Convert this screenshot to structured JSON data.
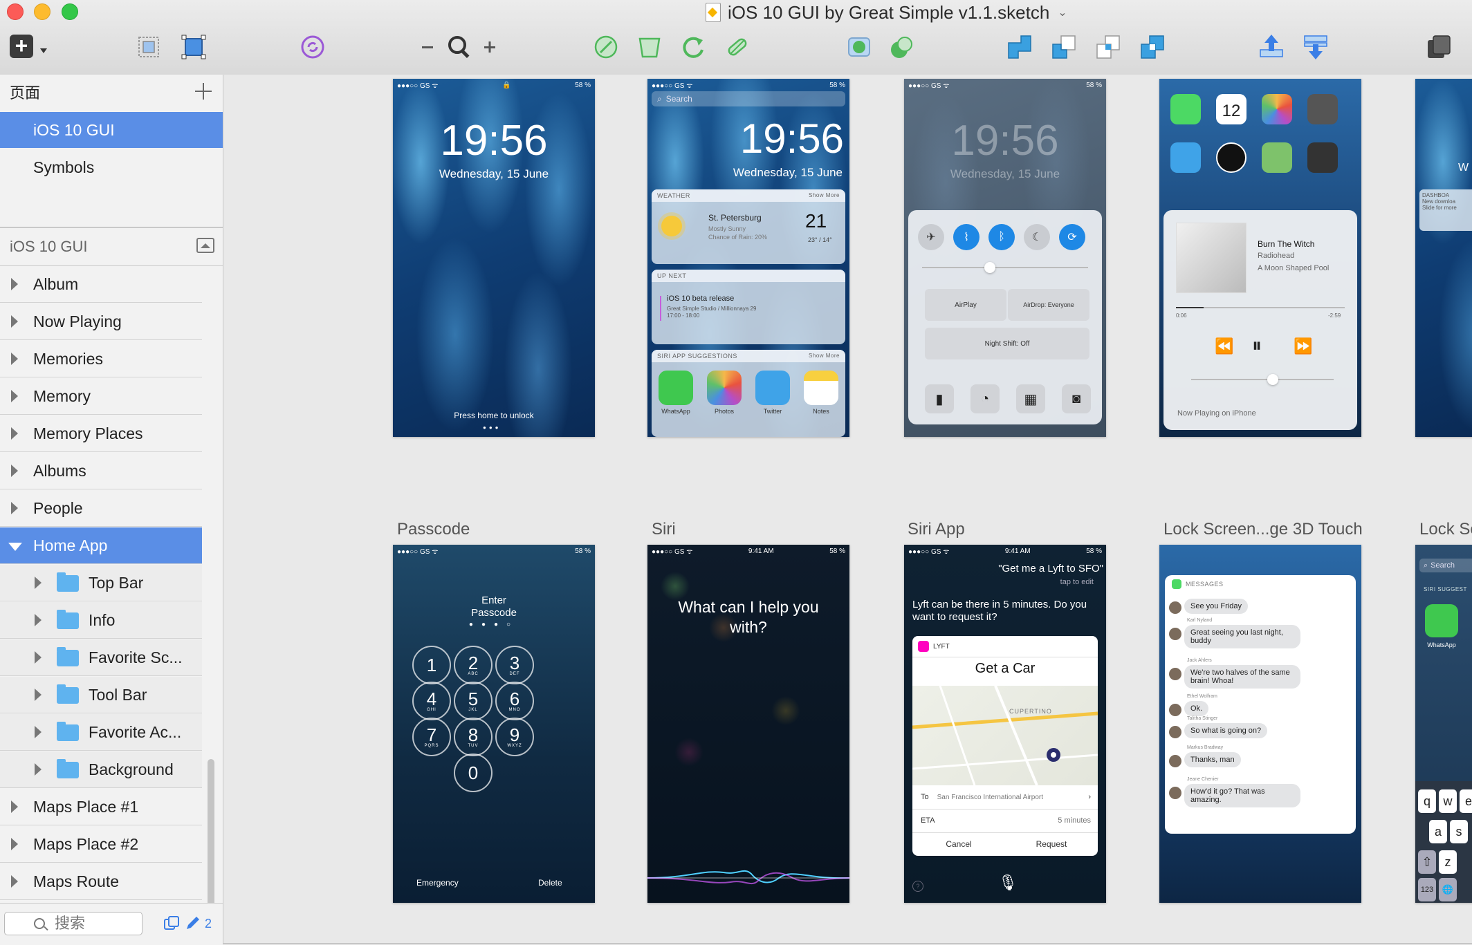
{
  "window": {
    "title": "iOS 10 GUI by Great Simple v1.1.sketch"
  },
  "pages": {
    "header": "页面",
    "items": [
      "iOS 10 GUI",
      "Symbols"
    ],
    "selected": "iOS 10 GUI"
  },
  "layers": {
    "header": "iOS 10 GUI",
    "items": [
      {
        "label": "Album"
      },
      {
        "label": "Now Playing"
      },
      {
        "label": "Memories"
      },
      {
        "label": "Memory"
      },
      {
        "label": "Memory Places"
      },
      {
        "label": "Albums"
      },
      {
        "label": "People"
      },
      {
        "label": "Home App"
      },
      {
        "label": "Top Bar"
      },
      {
        "label": "Info"
      },
      {
        "label": "Favorite Sc..."
      },
      {
        "label": "Tool Bar"
      },
      {
        "label": "Favorite Ac..."
      },
      {
        "label": "Background"
      },
      {
        "label": "Maps Place #1"
      },
      {
        "label": "Maps Place #2"
      },
      {
        "label": "Maps Route"
      }
    ]
  },
  "sidebar_bottom": {
    "search_placeholder": "搜索",
    "count": "2"
  },
  "artboards": {
    "row2_labels": [
      "Passcode",
      "Siri",
      "Siri App",
      "Lock Screen...ge 3D Touch",
      "Lock Sc"
    ],
    "lock": {
      "status_left": "●●●○○ GS ᯤ",
      "status_right": "58 %",
      "time": "19:56",
      "date": "Wednesday, 15 June",
      "hint": "Press home to unlock"
    },
    "today": {
      "search": "Search",
      "time": "19:56",
      "date": "Wednesday, 15 June",
      "weather": {
        "header": "WEATHER",
        "more": "Show More",
        "city": "St. Petersburg",
        "desc": "Mostly Sunny",
        "rain": "Chance of Rain: 20%",
        "temp": "21",
        "hilo": "23° / 14°"
      },
      "upnext": {
        "header": "UP NEXT",
        "title": "iOS 10 beta release",
        "place": "Great Simple Studio / Millionnaya 29",
        "time": "17:00 - 18:00"
      },
      "siri": {
        "header": "SIRI APP SUGGESTIONS",
        "more": "Show More",
        "apps": [
          "WhatsApp",
          "Photos",
          "Twitter",
          "Notes"
        ]
      }
    },
    "control": {
      "status_right": "58 %",
      "time": "19:56",
      "date": "Wednesday, 15 June",
      "airplay": "AirPlay",
      "airdrop": "AirDrop: Everyone",
      "nightshift": "Night Shift: Off"
    },
    "nowplaying": {
      "icons_row1": [
        "Messages",
        "Calendar",
        "Photos",
        "Camera"
      ],
      "icons_row2": [
        "Weather",
        "Clock",
        "Maps",
        "Videos"
      ],
      "calendar_day": "12",
      "song": "Burn The Witch",
      "artist": "Radiohead",
      "album": "A Moon Shaped Pool",
      "elapsed": "0:06",
      "remaining": "-2:59",
      "device": "Now Playing on iPhone"
    },
    "partial_top": {
      "header": "DASHBOA",
      "body": "New downloa",
      "body2": "Slide for more",
      "letter": "W"
    },
    "passcode": {
      "status_right": "58 %",
      "title": "Enter Passcode",
      "keys": [
        {
          "d": "1",
          "s": ""
        },
        {
          "d": "2",
          "s": "ABC"
        },
        {
          "d": "3",
          "s": "DEF"
        },
        {
          "d": "4",
          "s": "GHI"
        },
        {
          "d": "5",
          "s": "JKL"
        },
        {
          "d": "6",
          "s": "MNO"
        },
        {
          "d": "7",
          "s": "PQRS"
        },
        {
          "d": "8",
          "s": "TUV"
        },
        {
          "d": "9",
          "s": "WXYZ"
        },
        {
          "d": "0",
          "s": ""
        }
      ],
      "emergency": "Emergency",
      "delete": "Delete"
    },
    "siri": {
      "status_center": "9:41 AM",
      "status_right": "58 %",
      "prompt": "What can I help you with?"
    },
    "siriapp": {
      "status_center": "9:41 AM",
      "status_right": "58 %",
      "query": "\"Get me a Lyft to SFO\"",
      "tap": "tap to edit",
      "reply": "Lyft can be there in 5 minutes. Do you want to request it?",
      "app": "LYFT",
      "card_title": "Get a Car",
      "map_label": "CUPERTINO",
      "to_label": "To",
      "to_value": "San Francisco International Airport",
      "eta_label": "ETA",
      "eta_value": "5 minutes",
      "cancel": "Cancel",
      "request": "Request"
    },
    "messages3d": {
      "header": "MESSAGES",
      "msgs": [
        {
          "name": "",
          "text": "See you Friday"
        },
        {
          "name": "Karl Nyland",
          "text": "Great seeing you last night, buddy"
        },
        {
          "name": "Jack Ahlers",
          "text": "We're two halves of the same brain! Whoa!"
        },
        {
          "name": "Ethel Wolfram",
          "text": "Ok."
        },
        {
          "name": "Talitha Stinger",
          "text": "So what is going on?"
        },
        {
          "name": "Markus Bradway",
          "text": "Thanks, man"
        },
        {
          "name": "Jeane Chenier",
          "text": "How'd it go? That was amazing."
        }
      ]
    },
    "partial_bottom": {
      "search": "Search",
      "siri": "SIRI SUGGEST",
      "app": "WhatsApp",
      "keys_row1": [
        "q",
        "w",
        "e"
      ],
      "keys_row2": [
        "a",
        "s"
      ],
      "keys_row3": [
        "⇧",
        "z"
      ],
      "keys_row4": [
        "123",
        "🌐"
      ]
    }
  },
  "colors": {
    "accent": "#5a8ee6",
    "toolbar_green": "#4fb85b",
    "toolbar_blue": "#3aa0e0",
    "toolbar_purple": "#9b59d6"
  }
}
